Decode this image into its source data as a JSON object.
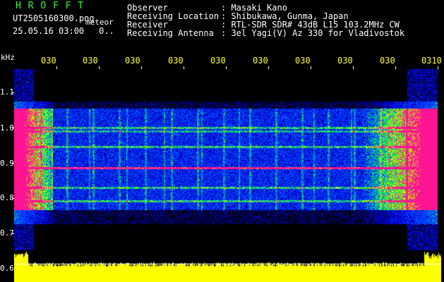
{
  "header": {
    "app_title": "H R O F F T",
    "filename": "UT2505160300.png",
    "file_suffix": "meteor",
    "datetime": "25.05.16 03:00",
    "counter": "0..",
    "labels": {
      "observer": "Observer",
      "location": "Receiving Location",
      "receiver": "Receiver",
      "antenna": "Receiving Antenna"
    },
    "values": {
      "observer": ": Masaki Kano",
      "location": ": Shibukawa, Gunma, Japan",
      "receiver": ": RTL-SDR SDR# 43dB L15 103.2MHz CW",
      "antenna": ": 3el Yagi(V) Az 330 for Vladivostok"
    }
  },
  "axis": {
    "unit": "kHz",
    "y_ticks": [
      "1.1",
      "1.0",
      "0.9",
      "0.8",
      "0.7",
      "0.6"
    ],
    "x_ticks": [
      "030",
      "030",
      "030",
      "030",
      "030",
      "030",
      "030",
      "030",
      "030",
      "0310"
    ]
  },
  "colors": {
    "background": "#000000",
    "title": "#33ff33",
    "text": "#ffffff",
    "time_labels": "#ffff33",
    "histogram": "#ffff00",
    "signal_strong": "#ff1493",
    "signal_mid": "#00ff66",
    "signal_low": "#0033cc"
  }
}
